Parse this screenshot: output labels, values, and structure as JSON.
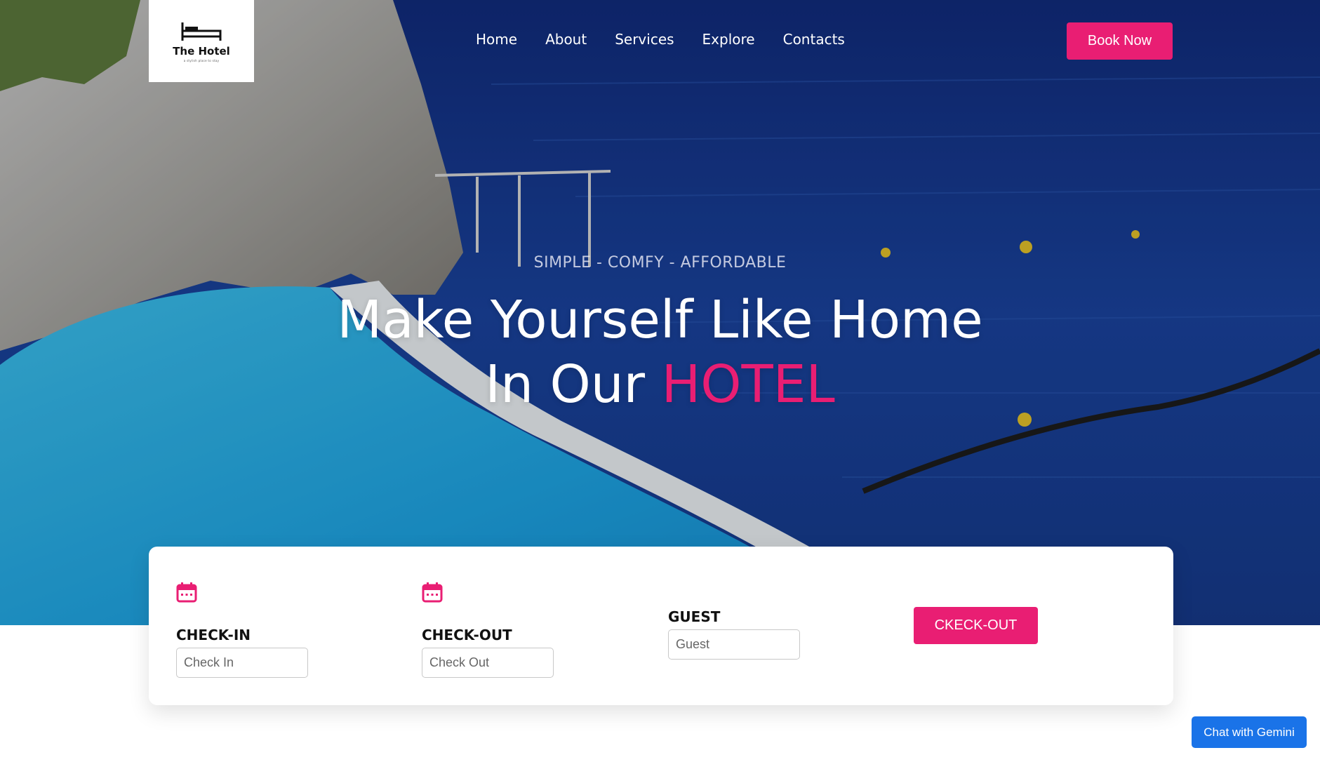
{
  "brand": {
    "name": "The Hotel",
    "tagline": "a stylish place to stay",
    "accent_color": "#e91e73",
    "logo_icon": "bed-icon"
  },
  "nav": {
    "items": [
      {
        "label": "Home"
      },
      {
        "label": "About"
      },
      {
        "label": "Services"
      },
      {
        "label": "Explore"
      },
      {
        "label": "Contacts"
      }
    ],
    "book_label": "Book Now"
  },
  "hero": {
    "tagline": "SIMPLE - COMFY - AFFORDABLE",
    "headline_line1": "Make Yourself Like Home",
    "headline_line2_prefix": "In Our ",
    "headline_accent": "HOTEL"
  },
  "booking": {
    "check_in": {
      "label": "CHECK-IN",
      "placeholder": "Check In",
      "icon": "calendar-icon"
    },
    "check_out": {
      "label": "CHECK-OUT",
      "placeholder": "Check Out",
      "icon": "calendar-icon"
    },
    "guest": {
      "label": "GUEST",
      "placeholder": "Guest"
    },
    "submit_label": "CKECK-OUT"
  },
  "chat": {
    "label": "Chat with Gemini",
    "color": "#1a73e8"
  }
}
